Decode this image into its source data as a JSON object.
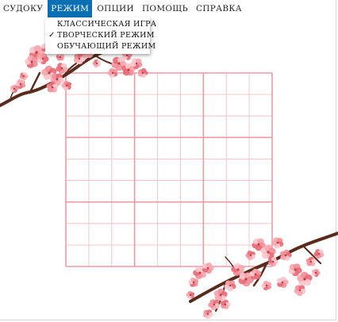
{
  "menubar": {
    "items": [
      {
        "label": "СУДОКУ"
      },
      {
        "label": "РЕЖИМ"
      },
      {
        "label": "ОПЦИИ"
      },
      {
        "label": "ПОМОЩЬ"
      },
      {
        "label": "СПРАВКА"
      }
    ]
  },
  "mode_menu": {
    "items": [
      {
        "label": "КЛАССИЧЕСКАЯ ИГРА"
      },
      {
        "label": "ТВОРЧЕСКИЙ РЕЖИМ",
        "checked": true
      },
      {
        "label": "ОБУЧАЮЩИЙ РЕЖИМ"
      }
    ],
    "check_glyph": "✓"
  },
  "board": {
    "size": 9,
    "thin_line_color": "#f4c3c8",
    "box_line_color": "#ee9aa3"
  },
  "decor": {
    "branch_color": "#5a2b1c",
    "blossom_colors": [
      "#f7a6ad",
      "#f08f98",
      "#e86a75",
      "#fbc6cb"
    ]
  }
}
